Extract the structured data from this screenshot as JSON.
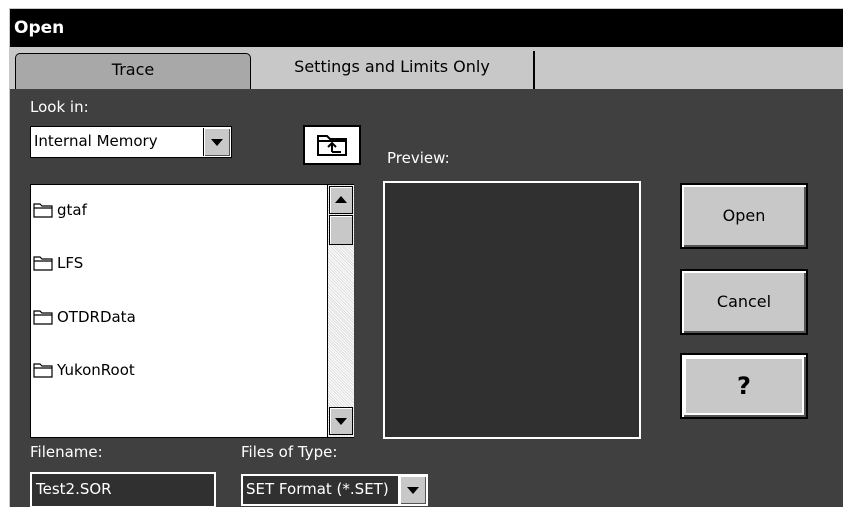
{
  "window": {
    "title": "Open"
  },
  "tabs": [
    {
      "label": "Trace",
      "active": false
    },
    {
      "label": "Settings and Limits Only",
      "active": true
    }
  ],
  "look_in": {
    "label": "Look in:",
    "selected": "Internal Memory"
  },
  "preview": {
    "label": "Preview:"
  },
  "files": [
    {
      "name": "gtaf",
      "icon": "folder-icon"
    },
    {
      "name": "LFS",
      "icon": "folder-icon"
    },
    {
      "name": "OTDRData",
      "icon": "folder-icon"
    },
    {
      "name": "YukonRoot",
      "icon": "folder-icon"
    }
  ],
  "buttons": {
    "open": "Open",
    "cancel": "Cancel",
    "help": "?"
  },
  "filename": {
    "label": "Filename:",
    "value": "Test2.SOR"
  },
  "file_type": {
    "label": "Files of Type:",
    "selected": "SET Format (*.SET)"
  },
  "colors": {
    "title_bar": "#000000",
    "dialog_bg": "#404040",
    "tab_bg": "#c8c8c8"
  }
}
